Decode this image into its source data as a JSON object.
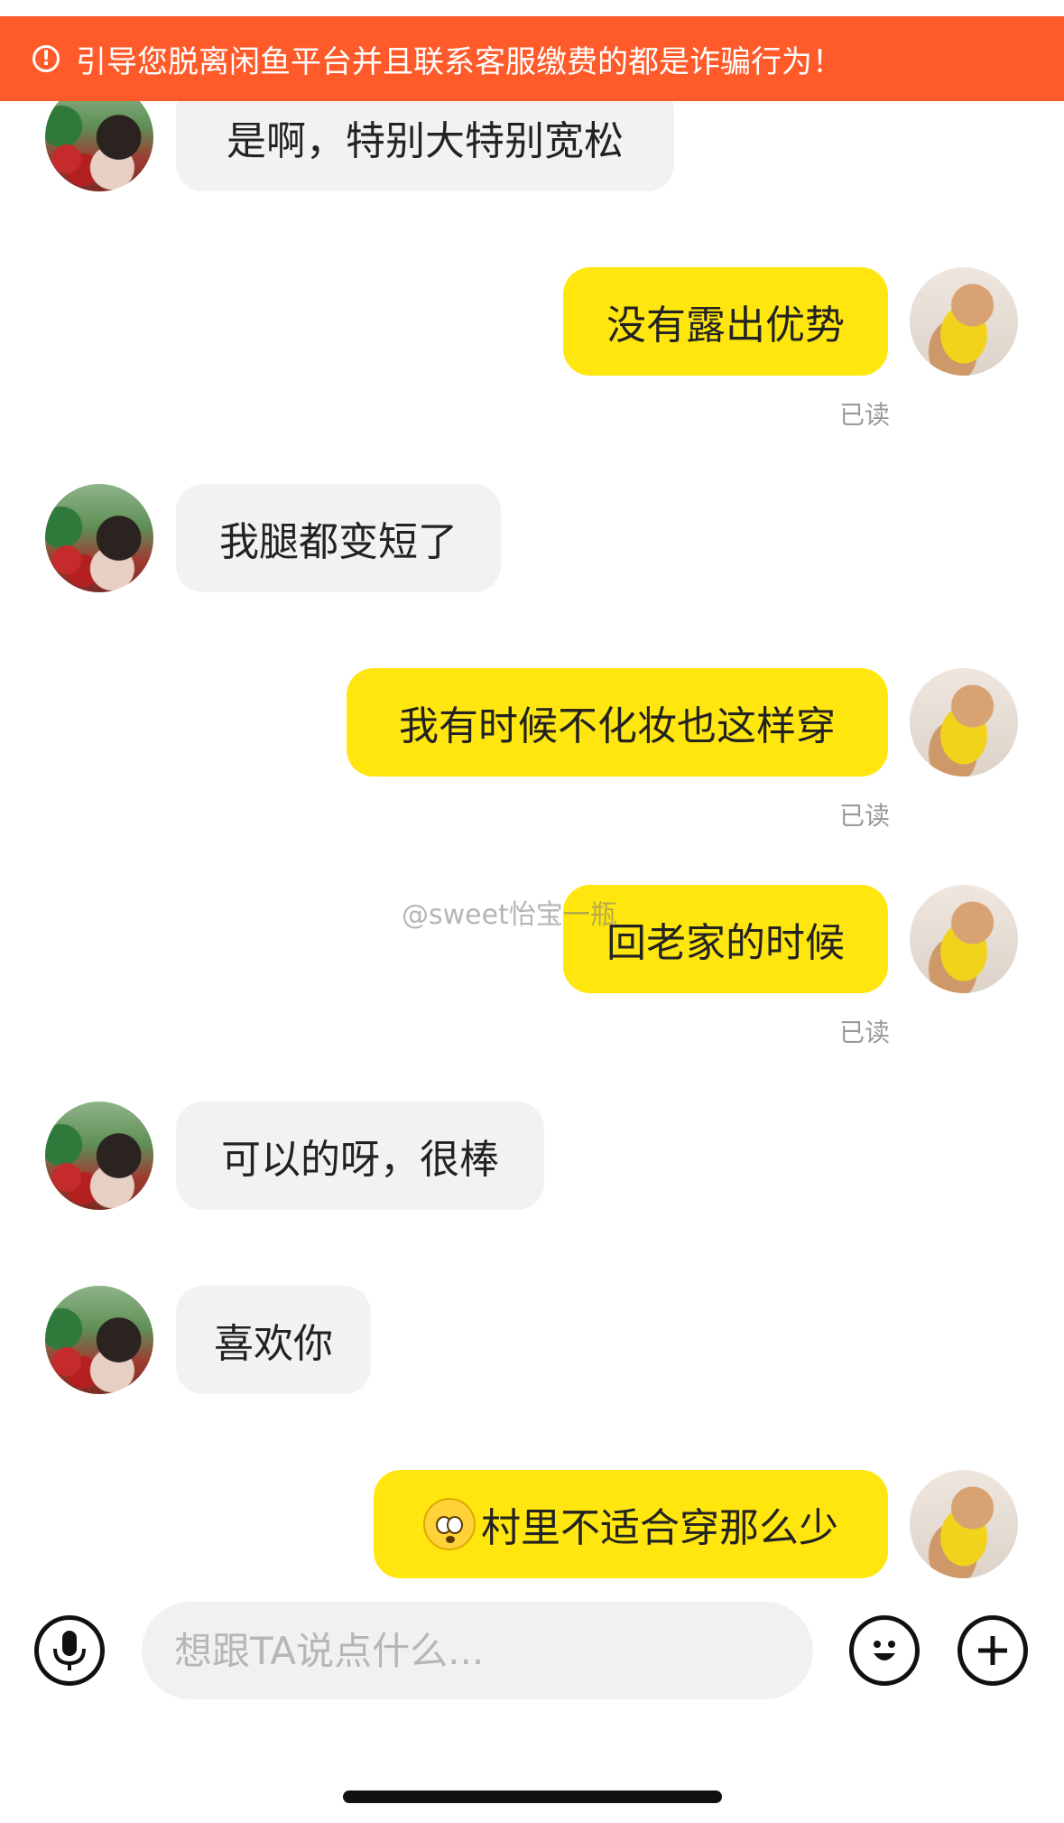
{
  "banner": {
    "icon": "alert-circle-icon",
    "text": "引导您脱离闲鱼平台并且联系客服缴费的都是诈骗行为！"
  },
  "messages": [
    {
      "side": "left",
      "text": "是啊，特别大特别宽松"
    },
    {
      "side": "right",
      "text": "没有露出优势",
      "status": "已读"
    },
    {
      "side": "left",
      "text": "我腿都变短了"
    },
    {
      "side": "right",
      "text": "我有时候不化妆也这样穿",
      "status": "已读"
    },
    {
      "side": "right",
      "text": "回老家的时候",
      "status": "已读"
    },
    {
      "side": "left",
      "text": "可以的呀，很棒"
    },
    {
      "side": "left",
      "text": "喜欢你"
    },
    {
      "side": "right",
      "emoji": "flushed-face-emoji",
      "text": "村里不适合穿那么少"
    }
  ],
  "watermark": "@sweet怡宝一瓶",
  "input": {
    "placeholder": "想跟TA说点什么..."
  },
  "toolbar": {
    "voice_icon": "microphone-icon",
    "emoji_icon": "smiley-face-icon",
    "plus_icon": "plus-icon"
  },
  "colors": {
    "banner": "#ff5a2a",
    "outgoing_bubble": "#ffe60f",
    "incoming_bubble": "#f2f2f3"
  }
}
